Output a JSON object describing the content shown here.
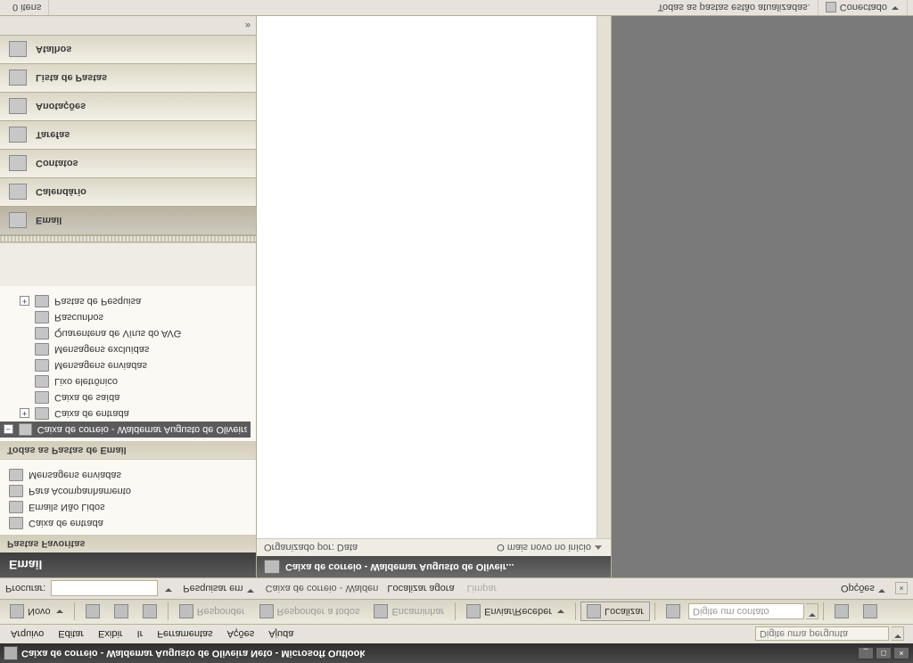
{
  "window": {
    "title": "Caixa de correio - Waldemar Augusto de Oliveira Neto - Microsoft Outlook"
  },
  "menu": {
    "items": [
      "Arquivo",
      "Editar",
      "Exibir",
      "Ir",
      "Ferramentas",
      "Ações",
      "Ajuda"
    ],
    "help_placeholder": "Digite uma pergunta"
  },
  "toolbar": {
    "new": "Novo",
    "reply": "Responder",
    "reply_all": "Responder a todos",
    "forward": "Encaminhar",
    "send_receive": "Enviar/Receber",
    "find": "Localizar",
    "contact_placeholder": "Digite um contato"
  },
  "findbar": {
    "label": "Procurar:",
    "search_in": "Pesquisar em",
    "scope": "Caixa de correio - Walden",
    "find_now": "Localizar agora",
    "clear": "Limpar",
    "options": "Opções"
  },
  "nav": {
    "header": "Email",
    "favorites_title": "Pastas Favoritas",
    "favorites": [
      "Caixa de entrada",
      "Emails Não Lidos",
      "Para Acompanhamento",
      "Mensagens enviadas"
    ],
    "all_folders_title": "Todas as Pastas de Email",
    "root": "Caixa de correio - Waldemar Augusto de Oliveira N",
    "folders": [
      "Caixa de entrada",
      "Caixa de saída",
      "Lixo eletrônico",
      "Mensagens enviadas",
      "Mensagens excluídas",
      "Quarentena de Vírus do AVG",
      "Rascunhos",
      "Pastas de Pesquisa"
    ],
    "stack": {
      "mail": "Email",
      "calendar": "Calendário",
      "contacts": "Contatos",
      "tasks": "Tarefas",
      "notes": "Anotações",
      "folder_list": "Lista de Pastas",
      "shortcuts": "Atalhos"
    }
  },
  "view": {
    "title": "Caixa de correio - Waldemar Augusto de Oliveir...",
    "arranged_by": "Organizado por: Data",
    "newest": "O mais novo no início"
  },
  "status": {
    "items": "0 itens",
    "updated": "Todas as pastas estão atualizadas.",
    "connected": "Conectado"
  }
}
